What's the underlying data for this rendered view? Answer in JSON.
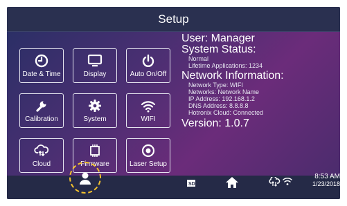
{
  "header": {
    "title": "Setup"
  },
  "tiles": [
    {
      "label": "Date & Time",
      "icon": "clock-icon"
    },
    {
      "label": "Display",
      "icon": "monitor-icon"
    },
    {
      "label": "Auto On/Off",
      "icon": "power-icon"
    },
    {
      "label": "Calibration",
      "icon": "wrench-icon"
    },
    {
      "label": "System",
      "icon": "gear-icon"
    },
    {
      "label": "WIFI",
      "icon": "wifi-icon"
    },
    {
      "label": "Cloud",
      "icon": "cloud-sync-icon"
    },
    {
      "label": "Firmware",
      "icon": "chip-icon"
    },
    {
      "label": "Laser Setup",
      "icon": "target-icon"
    }
  ],
  "info": {
    "user": "User: Manager",
    "system_status_title": "System Status:",
    "status": "Normal",
    "lifetime": "Lifetime Applications: 1234",
    "network_title": "Network Information:",
    "network_type": "Network Type: WIFI",
    "networks": "Networks: Network Name",
    "ip": "IP Address: 192.168.1.2",
    "dns": "DNS Address: 8.8.8.8",
    "cloud": "Hotronix Cloud: Connected",
    "version": "Version: 1.0.7"
  },
  "statusbar": {
    "sd_label": "SD",
    "time": "8:53 AM",
    "date": "1/23/2018"
  },
  "colors": {
    "accent_dashed": "#f2c12e",
    "topbar": "#2a3050",
    "bottombar": "#252a47"
  }
}
